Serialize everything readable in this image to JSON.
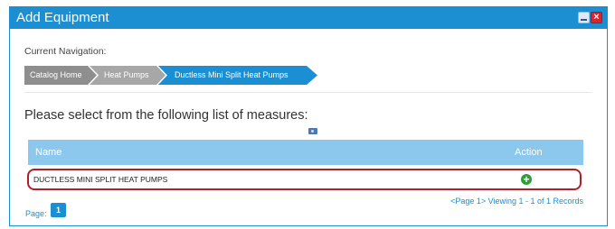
{
  "dialog": {
    "title": "Add Equipment",
    "close_glyph": "×",
    "minimize_icon": "minimize-icon",
    "close_icon": "close-icon"
  },
  "navigation": {
    "label": "Current Navigation:",
    "breadcrumbs": [
      {
        "label": "Catalog Home"
      },
      {
        "label": "Heat Pumps"
      },
      {
        "label": "Ductless Mini Split Heat Pumps"
      }
    ]
  },
  "measures": {
    "heading": "Please select from the following list of measures:",
    "columns": {
      "name": "Name",
      "action": "Action"
    },
    "rows": [
      {
        "name": "DUCTLESS MINI SPLIT HEAT PUMPS",
        "action_icon": "add-icon",
        "action_glyph": "+"
      }
    ]
  },
  "pagination": {
    "summary": "<Page 1> Viewing 1 - 1 of 1 Records",
    "page_label": "Page:",
    "current_page": "1"
  },
  "colors": {
    "accent": "#1b8fd1",
    "header_row": "#8cc8ee",
    "highlight_border": "#b0202a",
    "add_icon": "#2e9e3a"
  }
}
